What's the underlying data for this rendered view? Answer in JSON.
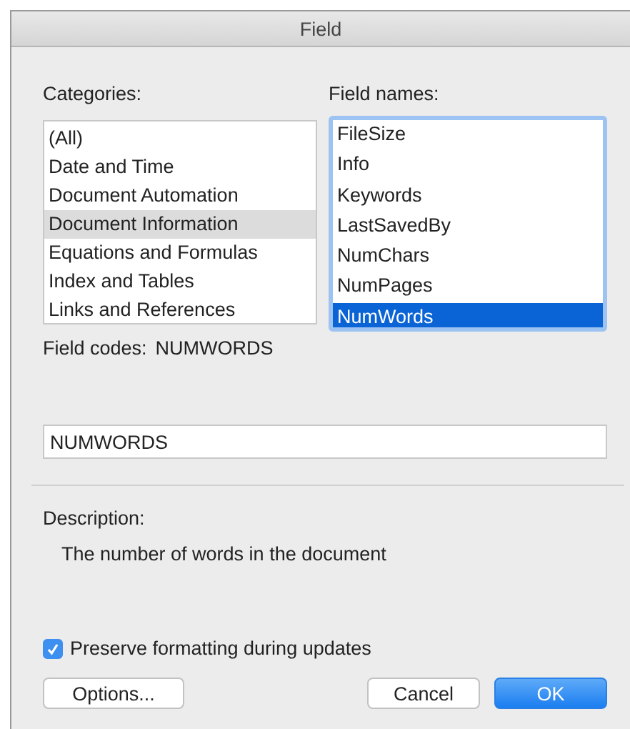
{
  "window": {
    "title": "Field"
  },
  "categories": {
    "label": "Categories:",
    "items": [
      {
        "label": "(All)",
        "selected": false
      },
      {
        "label": "Date and Time",
        "selected": false
      },
      {
        "label": "Document Automation",
        "selected": false
      },
      {
        "label": "Document Information",
        "selected": true
      },
      {
        "label": "Equations and Formulas",
        "selected": false
      },
      {
        "label": "Index and Tables",
        "selected": false
      },
      {
        "label": "Links and References",
        "selected": false
      }
    ]
  },
  "field_names": {
    "label": "Field names:",
    "items": [
      {
        "label": "FileSize",
        "selected": false
      },
      {
        "label": "Info",
        "selected": false
      },
      {
        "label": "Keywords",
        "selected": false
      },
      {
        "label": "LastSavedBy",
        "selected": false
      },
      {
        "label": "NumChars",
        "selected": false
      },
      {
        "label": "NumPages",
        "selected": false
      },
      {
        "label": "NumWords",
        "selected": true
      }
    ]
  },
  "field_codes": {
    "label": "Field codes:",
    "value": "NUMWORDS"
  },
  "code_field": {
    "value": "NUMWORDS"
  },
  "description": {
    "label": "Description:",
    "text": "The number of words in the document"
  },
  "preserve_formatting": {
    "label": "Preserve formatting during updates",
    "checked": true
  },
  "buttons": [
    {
      "label": "Options...",
      "default": false
    },
    {
      "label": "Cancel",
      "default": false
    },
    {
      "label": "OK",
      "default": true
    }
  ]
}
